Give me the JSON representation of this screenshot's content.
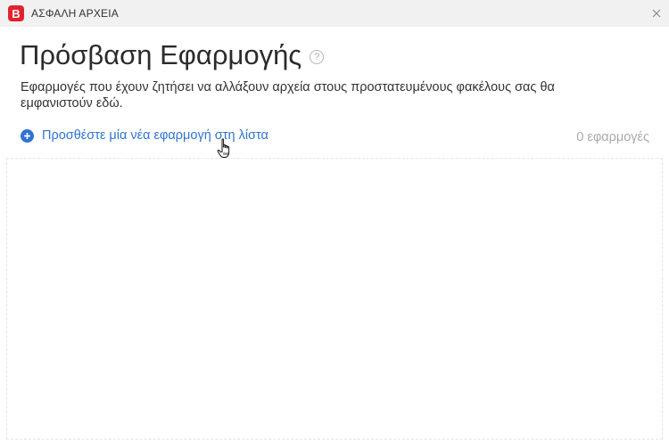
{
  "window": {
    "title": "ΑΣΦΑΛΗ ΑΡΧΕΙΑ",
    "logo_letter": "B",
    "close_glyph": "×"
  },
  "header": {
    "title": "Πρόσβαση Εφαρμογής",
    "help_glyph": "?"
  },
  "description": "Εφαρμογές που έχουν ζητήσει να αλλάξουν αρχεία στους προστατευμένους φακέλους σας θα εμφανιστούν εδώ.",
  "actions": {
    "add_label": "Προσθέστε μία νέα εφαρμογή στη λίστα"
  },
  "list": {
    "count_label": "0 εφαρμογές",
    "items": []
  },
  "icons": {
    "logo": "bitdefender-logo-icon",
    "help": "question-circle-icon",
    "add": "plus-circle-icon",
    "close": "close-icon",
    "cursor": "hand-pointer-icon"
  },
  "colors": {
    "brand_red": "#e0242f",
    "accent_blue": "#2f74cf",
    "title_bar": "#f1f1f1",
    "muted_text": "#a9a9a9"
  }
}
